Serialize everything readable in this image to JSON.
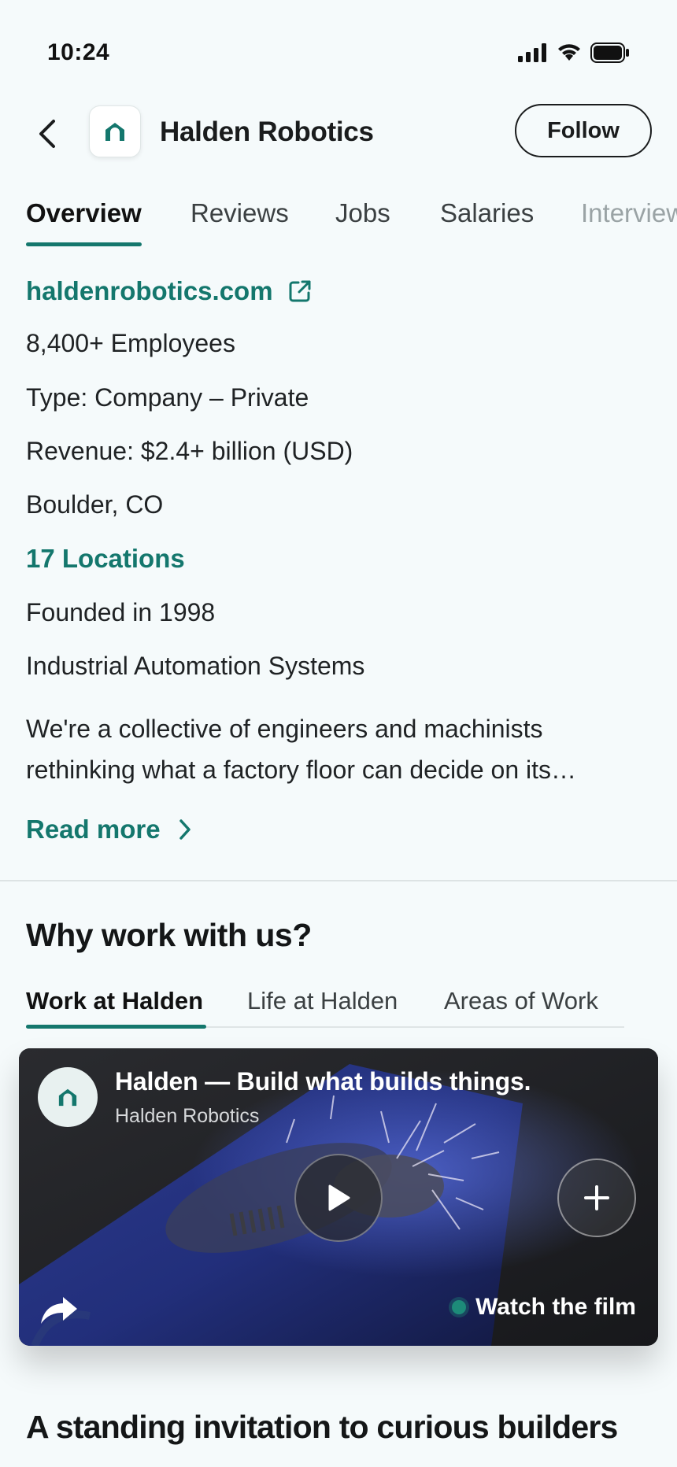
{
  "status_bar": {
    "time": "10:24"
  },
  "header": {
    "company_name": "Halden Robotics",
    "follow_label": "Follow"
  },
  "tabs": [
    {
      "label": "Overview"
    },
    {
      "label": "Reviews"
    },
    {
      "label": "Jobs"
    },
    {
      "label": "Salaries"
    },
    {
      "label": "Interviews"
    }
  ],
  "overview": {
    "website": "haldenrobotics.com",
    "employees": "8,400+ Employees",
    "type": "Type: Company – Private",
    "revenue": "Revenue: $2.4+ billion (USD)",
    "location": "Boulder, CO",
    "locations_link": "17 Locations",
    "founded": "Founded in 1998",
    "industry": "Industrial Automation Systems",
    "description": "We're a collective of engineers and machinists rethinking what a factory floor can decide on its…",
    "read_more": "Read more"
  },
  "why_work": {
    "title": "Why work with us?",
    "tabs": [
      {
        "label": "Work at Halden"
      },
      {
        "label": "Life at Halden"
      },
      {
        "label": "Areas of Work"
      }
    ],
    "video": {
      "title": "Halden — Build what builds things.",
      "subtitle": "Halden Robotics",
      "watch_label": "Watch the film"
    }
  },
  "next_section": {
    "title": "A standing invitation to curious builders"
  },
  "colors": {
    "accent": "#14776d",
    "background": "#f5fafb",
    "text": "#1d1f20"
  }
}
